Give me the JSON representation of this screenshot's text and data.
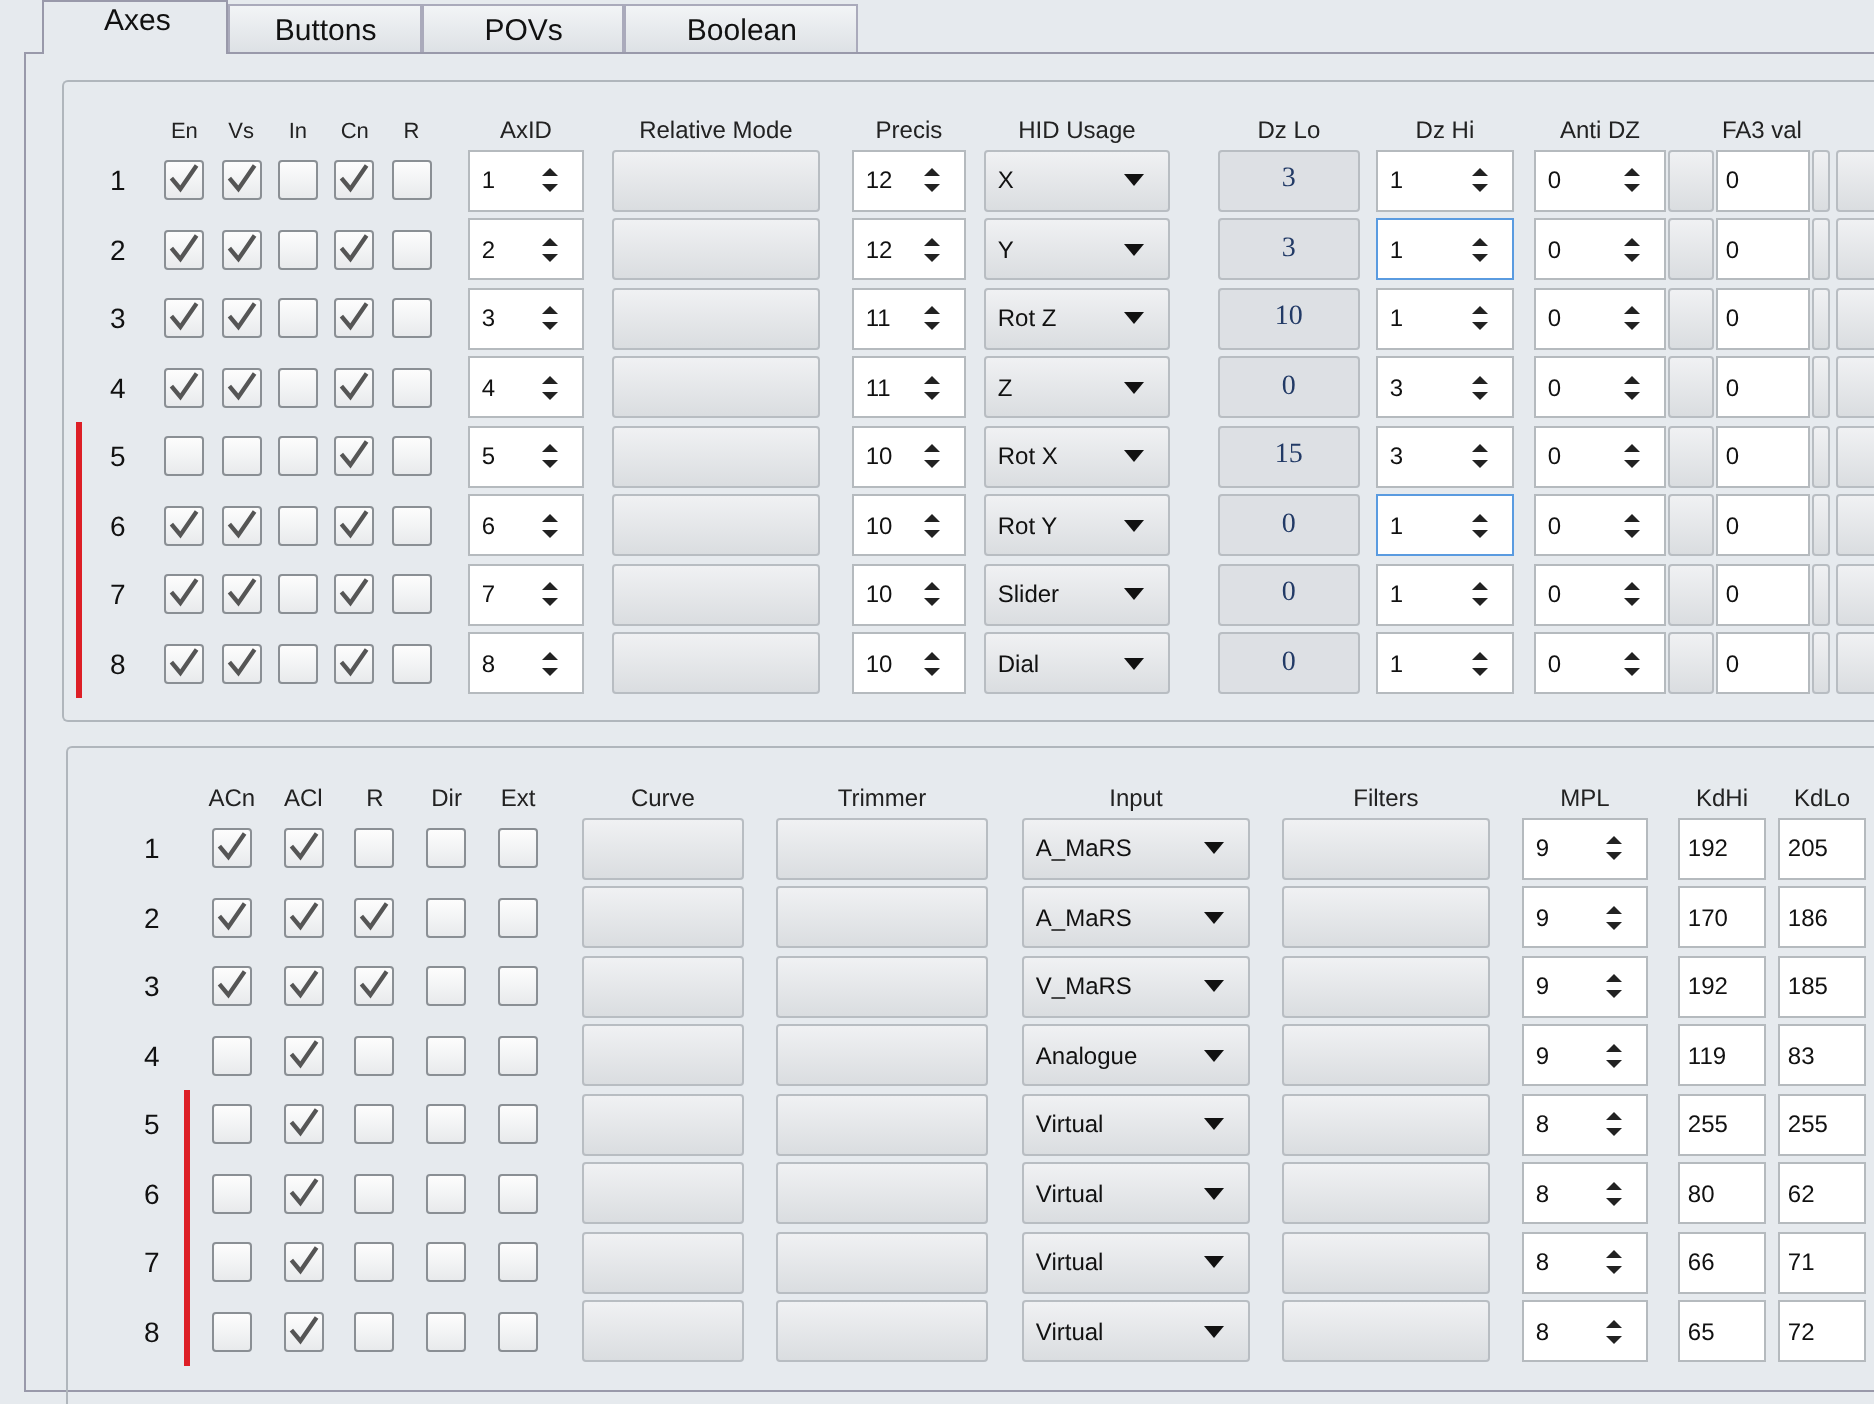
{
  "tabs": [
    {
      "label": "Axes",
      "selected": true
    },
    {
      "label": "Buttons",
      "selected": false
    },
    {
      "label": "POVs",
      "selected": false
    },
    {
      "label": "Boolean",
      "selected": false
    }
  ],
  "axes": {
    "check_headers": [
      "En",
      "Vs",
      "In",
      "Cn",
      "R"
    ],
    "headers": [
      "AxID",
      "Relative Mode",
      "Precis",
      "HID Usage",
      "Dz Lo",
      "Dz Hi",
      "Anti DZ",
      "FA3 val"
    ],
    "rows": [
      {
        "number": "1",
        "checks": [
          true,
          true,
          false,
          true,
          false
        ],
        "axid": "1",
        "precis": "12",
        "hid_usage": "X",
        "dz_lo": "3",
        "dz_hi": "1",
        "highlighted": false,
        "anti_dz": "0",
        "fa3_val": "0",
        "marked": false
      },
      {
        "number": "2",
        "checks": [
          true,
          true,
          false,
          true,
          false
        ],
        "axid": "2",
        "precis": "12",
        "hid_usage": "Y",
        "dz_lo": "3",
        "dz_hi": "1",
        "highlighted": true,
        "anti_dz": "0",
        "fa3_val": "0",
        "marked": false
      },
      {
        "number": "3",
        "checks": [
          true,
          true,
          false,
          true,
          false
        ],
        "axid": "3",
        "precis": "11",
        "hid_usage": "Rot Z",
        "dz_lo": "10",
        "dz_hi": "1",
        "highlighted": false,
        "anti_dz": "0",
        "fa3_val": "0",
        "marked": false
      },
      {
        "number": "4",
        "checks": [
          true,
          true,
          false,
          true,
          false
        ],
        "axid": "4",
        "precis": "11",
        "hid_usage": "Z",
        "dz_lo": "0",
        "dz_hi": "3",
        "highlighted": false,
        "anti_dz": "0",
        "fa3_val": "0",
        "marked": false
      },
      {
        "number": "5",
        "checks": [
          false,
          false,
          false,
          true,
          false
        ],
        "axid": "5",
        "precis": "10",
        "hid_usage": "Rot X",
        "dz_lo": "15",
        "dz_hi": "3",
        "highlighted": false,
        "anti_dz": "0",
        "fa3_val": "0",
        "marked": true
      },
      {
        "number": "6",
        "checks": [
          true,
          true,
          false,
          true,
          false
        ],
        "axid": "6",
        "precis": "10",
        "hid_usage": "Rot Y",
        "dz_lo": "0",
        "dz_hi": "1",
        "highlighted": true,
        "anti_dz": "0",
        "fa3_val": "0",
        "marked": true
      },
      {
        "number": "7",
        "checks": [
          true,
          true,
          false,
          true,
          false
        ],
        "axid": "7",
        "precis": "10",
        "hid_usage": "Slider",
        "dz_lo": "0",
        "dz_hi": "1",
        "highlighted": false,
        "anti_dz": "0",
        "fa3_val": "0",
        "marked": true
      },
      {
        "number": "8",
        "checks": [
          true,
          true,
          false,
          true,
          false
        ],
        "axid": "8",
        "precis": "10",
        "hid_usage": "Dial",
        "dz_lo": "0",
        "dz_hi": "1",
        "highlighted": false,
        "anti_dz": "0",
        "fa3_val": "0",
        "marked": true
      }
    ]
  },
  "curves": {
    "check_headers": [
      "ACn",
      "ACl",
      "R",
      "Dir",
      "Ext"
    ],
    "headers": [
      "Curve",
      "Trimmer",
      "Input",
      "Filters",
      "MPL",
      "KdHi",
      "KdLo"
    ],
    "rows": [
      {
        "number": "1",
        "checks": [
          true,
          true,
          false,
          false,
          false
        ],
        "input": "A_MaRS",
        "mpl": "9",
        "kd_hi": "192",
        "kd_lo": "205",
        "marked": false
      },
      {
        "number": "2",
        "checks": [
          true,
          true,
          true,
          false,
          false
        ],
        "input": "A_MaRS",
        "mpl": "9",
        "kd_hi": "170",
        "kd_lo": "186",
        "marked": false
      },
      {
        "number": "3",
        "checks": [
          true,
          true,
          true,
          false,
          false
        ],
        "input": "V_MaRS",
        "mpl": "9",
        "kd_hi": "192",
        "kd_lo": "185",
        "marked": false
      },
      {
        "number": "4",
        "checks": [
          false,
          true,
          false,
          false,
          false
        ],
        "input": "Analogue",
        "mpl": "9",
        "kd_hi": "119",
        "kd_lo": "83",
        "marked": false
      },
      {
        "number": "5",
        "checks": [
          false,
          true,
          false,
          false,
          false
        ],
        "input": "Virtual",
        "mpl": "8",
        "kd_hi": "255",
        "kd_lo": "255",
        "marked": true
      },
      {
        "number": "6",
        "checks": [
          false,
          true,
          false,
          false,
          false
        ],
        "input": "Virtual",
        "mpl": "8",
        "kd_hi": "80",
        "kd_lo": "62",
        "marked": true
      },
      {
        "number": "7",
        "checks": [
          false,
          true,
          false,
          false,
          false
        ],
        "input": "Virtual",
        "mpl": "8",
        "kd_hi": "66",
        "kd_lo": "71",
        "marked": true
      },
      {
        "number": "8",
        "checks": [
          false,
          true,
          false,
          false,
          false
        ],
        "input": "Virtual",
        "mpl": "8",
        "kd_hi": "65",
        "kd_lo": "72",
        "marked": true
      }
    ]
  }
}
